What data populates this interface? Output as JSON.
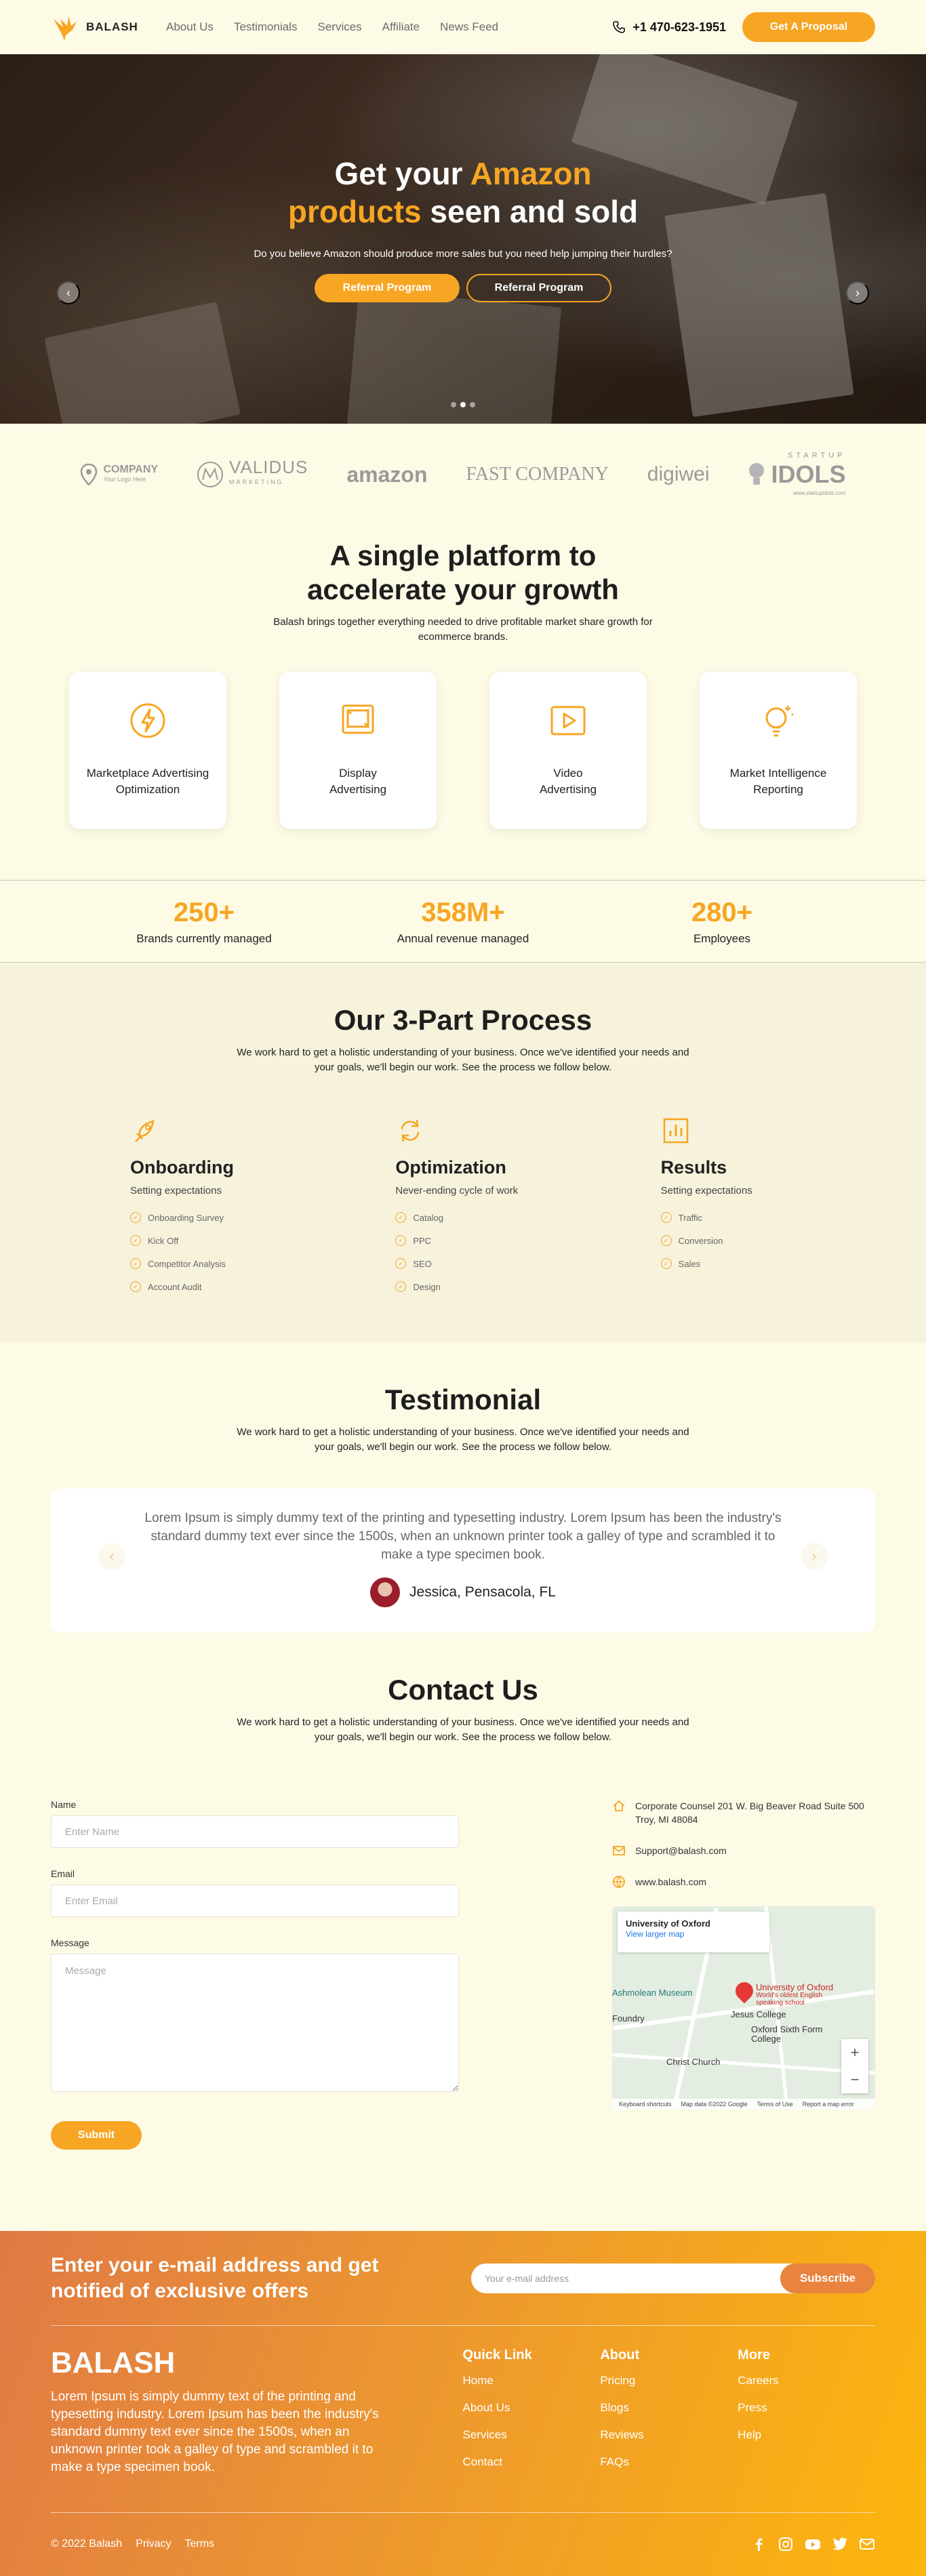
{
  "nav": {
    "brand": "BALASH",
    "links": [
      "About Us",
      "Testimonials",
      "Services",
      "Affiliate",
      "News Feed"
    ],
    "phone": "+1 470-623-1951",
    "cta": "Get A Proposal"
  },
  "hero": {
    "title_part1": "Get your ",
    "title_hl1": "Amazon",
    "title_hl2": "products",
    "title_part2": " seen and sold",
    "subtitle": "Do you believe Amazon should produce more sales but you need help jumping their hurdles?",
    "button1": "Referral Program",
    "button2": "Referral Program",
    "prev": "‹",
    "next": "›"
  },
  "logos": {
    "items": [
      "COMPANY",
      "VALIDUS",
      "amazon",
      "FAST COMPANY",
      "digiwei",
      "IDOLS"
    ],
    "company_tagline": "Your Logo Here",
    "validus_tagline": "MARKETING",
    "idols_top": "STARTUP",
    "idols_url": "www.startupidols.com"
  },
  "platform": {
    "title": "A single platform to accelerate your growth",
    "subtitle": "Balash brings together everything needed to drive profitable market share growth for ecommerce brands.",
    "cards": [
      {
        "label": "Marketplace Advertising Optimization",
        "icon": "lightning-icon"
      },
      {
        "label": "Display Advertising",
        "icon": "display-icon"
      },
      {
        "label": "Video Advertising",
        "icon": "video-icon"
      },
      {
        "label": "Market Intelligence Reporting",
        "icon": "lightbulb-icon"
      }
    ]
  },
  "stats": [
    {
      "value": "250+",
      "label": "Brands currently managed"
    },
    {
      "value": "358M+",
      "label": "Annual revenue managed"
    },
    {
      "value": "280+",
      "label": "Employees"
    }
  ],
  "process": {
    "title": "Our 3-Part Process",
    "subtitle": "We work hard to get a holistic understanding of your business. Once we've identified your needs and your goals, we'll begin our work. See the process we follow below.",
    "columns": [
      {
        "title": "Onboarding",
        "sub": "Setting expectations",
        "items": [
          "Onboarding Survey",
          "Kick Off",
          "Competitor Analysis",
          "Account Audit"
        ]
      },
      {
        "title": "Optimization",
        "sub": "Never-ending cycle of work",
        "items": [
          "Catalog",
          "PPC",
          "SEO",
          "Design"
        ]
      },
      {
        "title": "Results",
        "sub": "Setting expectations",
        "items": [
          "Traffic",
          "Conversion",
          "Sales"
        ]
      }
    ]
  },
  "testimonial": {
    "title": "Testimonial",
    "subtitle": "We work hard to get a holistic understanding of your business. Once we've identified your needs and your goals, we'll begin our work. See the process we follow below.",
    "quote": "Lorem Ipsum is simply dummy text of the printing and typesetting industry. Lorem Ipsum has been the industry's standard dummy text ever since the 1500s, when an unknown printer took a galley of type and scrambled it to make a type specimen book.",
    "author": "Jessica, Pensacola, FL",
    "prev": "‹",
    "next": "›"
  },
  "contact": {
    "title": "Contact Us",
    "subtitle": "We work hard to get a holistic understanding of your business. Once we've identified your needs and your goals, we'll begin our work. See the process we follow below.",
    "name_label": "Name",
    "name_placeholder": "Enter Name",
    "email_label": "Email",
    "email_placeholder": "Enter Email",
    "message_label": "Message",
    "message_placeholder": "Message",
    "submit": "Submit",
    "address": "Corporate Counsel 201 W. Big Beaver Road Suite 500 Troy, MI 48084",
    "email": "Support@balash.com",
    "website": "www.balash.com",
    "map": {
      "place": "University of Oxford",
      "link": "View larger map",
      "pin_label": "University of Oxford",
      "pin_sub": "World's oldest English speaking school",
      "label_museum": "Ashmolean Museum",
      "label_jesus": "Jesus College",
      "label_oxford": "Oxford Sixth Form College",
      "label_christ": "Christ Church",
      "label_foundry": "Foundry",
      "zoom_in": "+",
      "zoom_out": "−",
      "footer": [
        "Keyboard shortcuts",
        "Map data ©2022 Google",
        "Terms of Use",
        "Report a map error"
      ]
    }
  },
  "footer": {
    "newsletter_title": "Enter your e-mail address and get notified of exclusive offers",
    "newsletter_placeholder": "Your e-mail address",
    "subscribe": "Subscribe",
    "brand": "BALASH",
    "brand_text": "Lorem Ipsum is simply dummy text of the printing and typesetting industry. Lorem Ipsum has been the industry's standard dummy text ever since the 1500s, when an unknown printer took a galley of type and scrambled it to make a type specimen book.",
    "columns": [
      {
        "title": "Quick Link",
        "items": [
          "Home",
          "About Us",
          "Services",
          "Contact"
        ]
      },
      {
        "title": "About",
        "items": [
          "Pricing",
          "Blogs",
          "Reviews",
          "FAQs"
        ]
      },
      {
        "title": "More",
        "items": [
          "Careers",
          "Press",
          "Help"
        ]
      }
    ],
    "copyright": "© 2022 Balash",
    "privacy": "Privacy",
    "terms": "Terms",
    "socials": [
      "facebook-icon",
      "instagram-icon",
      "youtube-icon",
      "twitter-icon",
      "mail-icon"
    ]
  },
  "colors": {
    "accent": "#f6a623",
    "background": "#fdfae6",
    "process_bg": "#f7f2dc"
  }
}
